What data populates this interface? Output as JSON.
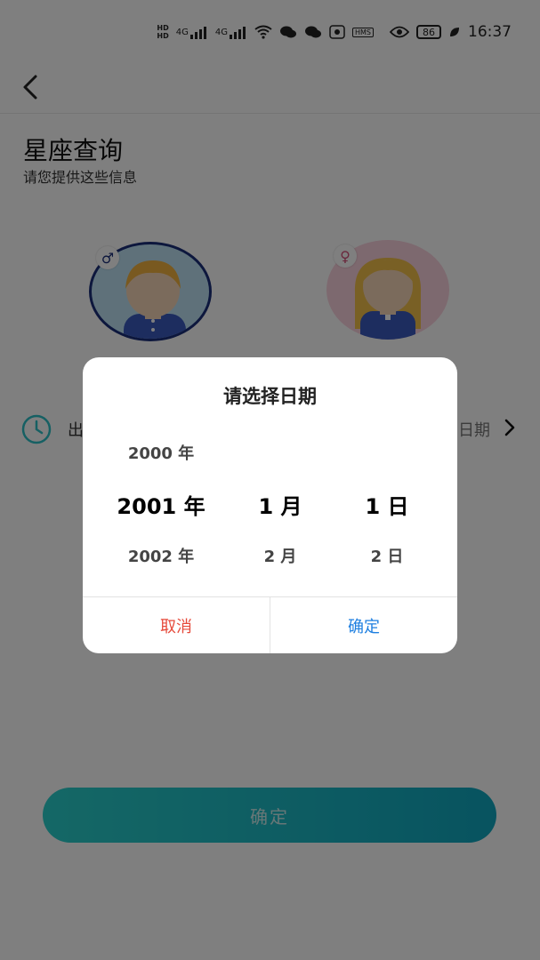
{
  "status_bar": {
    "hd1": "HD",
    "hd2": "HD",
    "net1": "4G",
    "net2": "4G",
    "hms": "HMS",
    "battery": "86",
    "time": "16:37",
    "icons": [
      "hd-icon",
      "signal-icon",
      "wifi-icon",
      "wechat-icon",
      "eye-icon",
      "battery-icon",
      "leaf-icon"
    ]
  },
  "header": {
    "back_icon": "chevron-left-icon"
  },
  "page": {
    "title": "星座查询",
    "subtitle": "请您提供这些信息"
  },
  "gender": {
    "male_symbol": "♂",
    "female_symbol": "♀"
  },
  "birth": {
    "label": "出",
    "value": "日期"
  },
  "main_button": {
    "label": "确定"
  },
  "dialog": {
    "title": "请选择日期",
    "year": {
      "prev": "2000 年",
      "current": "2001 年",
      "next": "2002 年"
    },
    "month": {
      "prev": "",
      "current": "1 月",
      "next": "2 月"
    },
    "day": {
      "prev": "",
      "current": "1 日",
      "next": "2 日"
    },
    "cancel": "取消",
    "ok": "确定"
  },
  "colors": {
    "overlay": "#000000",
    "accent_teal": "#1ab8c6",
    "cancel_red": "#e64a3b",
    "ok_blue": "#1e7fe0",
    "male_ring": "#1b2f7a"
  }
}
